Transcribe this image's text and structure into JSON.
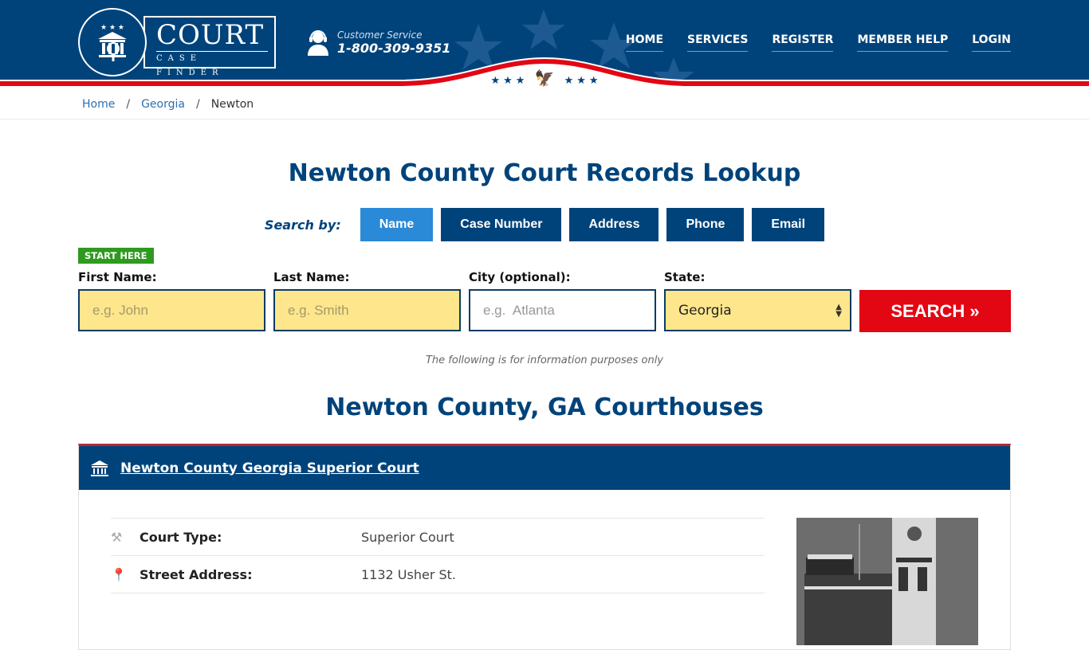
{
  "header": {
    "logo": {
      "title": "COURT",
      "subtitle": "CASE FINDER"
    },
    "customer_service": {
      "label": "Customer Service",
      "phone": "1-800-309-9351"
    },
    "nav": [
      "HOME",
      "SERVICES",
      "REGISTER",
      "MEMBER HELP",
      "LOGIN"
    ]
  },
  "breadcrumb": [
    {
      "label": "Home",
      "link": true
    },
    {
      "label": "Georgia",
      "link": true
    },
    {
      "label": "Newton",
      "link": false
    }
  ],
  "page_title": "Newton County Court Records Lookup",
  "search": {
    "search_by_label": "Search by:",
    "tabs": [
      {
        "label": "Name",
        "active": true
      },
      {
        "label": "Case Number",
        "active": false
      },
      {
        "label": "Address",
        "active": false
      },
      {
        "label": "Phone",
        "active": false
      },
      {
        "label": "Email",
        "active": false
      }
    ],
    "start_badge": "START HERE",
    "fields": {
      "first_name": {
        "label": "First Name:",
        "placeholder": "e.g. John",
        "value": ""
      },
      "last_name": {
        "label": "Last Name:",
        "placeholder": "e.g. Smith",
        "value": ""
      },
      "city": {
        "label": "City (optional):",
        "placeholder": "e.g.  Atlanta",
        "value": ""
      },
      "state": {
        "label": "State:",
        "value": "Georgia"
      }
    },
    "button": "SEARCH »"
  },
  "info_note": "The following is for information purposes only",
  "section_title": "Newton County, GA Courthouses",
  "courthouse": {
    "name": "Newton County Georgia Superior Court",
    "rows": [
      {
        "icon": "gavel-icon",
        "key": "Court Type:",
        "value": "Superior Court"
      },
      {
        "icon": "map-pin-icon",
        "key": "Street Address:",
        "value": "1132 Usher St."
      }
    ]
  },
  "colors": {
    "navy": "#00437a",
    "active_tab": "#2a8ad8",
    "search_red": "#e30613",
    "input_yellow": "#fde68c",
    "start_green": "#2e9a1e"
  }
}
